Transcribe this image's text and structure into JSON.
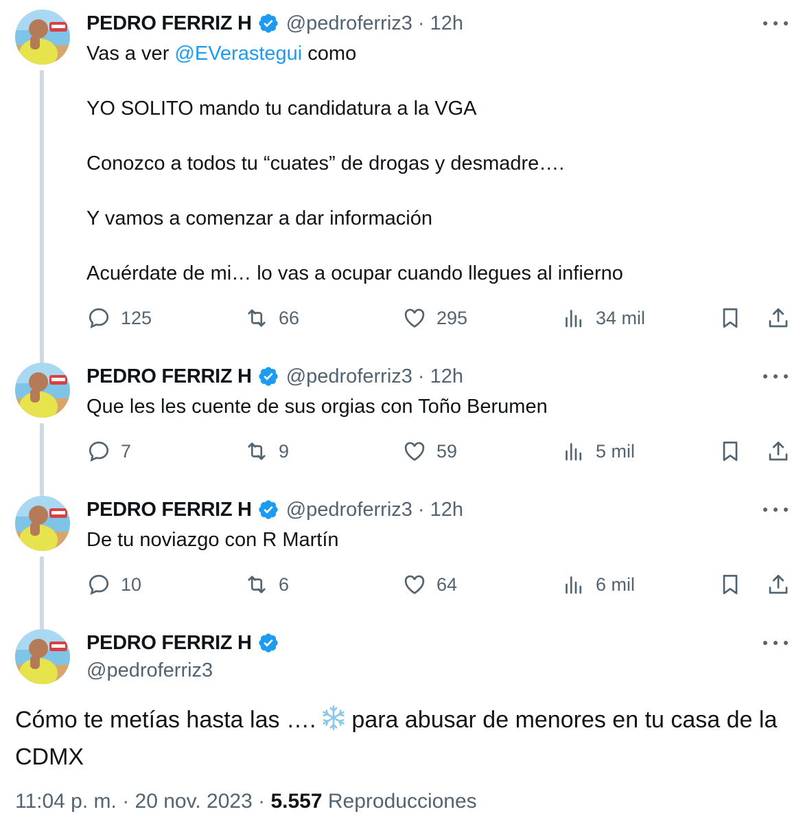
{
  "author": {
    "name": "PEDRO FERRIZ H",
    "handle": "@pedroferriz3",
    "verified_color": "#1d9bf0"
  },
  "separator": "·",
  "tweets": [
    {
      "time": "12h",
      "intro_prefix": "Vas a ver ",
      "mention": "@EVerastegui",
      "intro_suffix": " como",
      "lines": [
        "YO SOLITO mando tu candidatura a la VGA",
        "Conozco a todos tu “cuates” de drogas y desmadre….",
        "Y vamos a comenzar a dar información",
        "Acuérdate de mi… lo vas a ocupar cuando llegues al infierno"
      ],
      "replies": "125",
      "retweets": "66",
      "likes": "295",
      "views": "34 mil"
    },
    {
      "time": "12h",
      "text": "Que les les cuente de sus orgias con Toño Berumen",
      "replies": "7",
      "retweets": "9",
      "likes": "59",
      "views": "5 mil"
    },
    {
      "time": "12h",
      "text": "De tu noviazgo con R Martín",
      "replies": "10",
      "retweets": "6",
      "likes": "64",
      "views": "6 mil"
    }
  ],
  "main": {
    "text_before": "Cómo te metías hasta las ….",
    "emoji": "snowflake-icon",
    "text_after": "para abusar de menores en tu casa de la CDMX",
    "timestamp": "11:04 p. m. · 20 nov. 2023 ·",
    "views_count": "5.557",
    "views_label": "Reproducciones"
  },
  "colors": {
    "text": "#0f1419",
    "secondary": "#536471",
    "accent": "#1d9bf0",
    "thread_line": "#cfd9de"
  }
}
